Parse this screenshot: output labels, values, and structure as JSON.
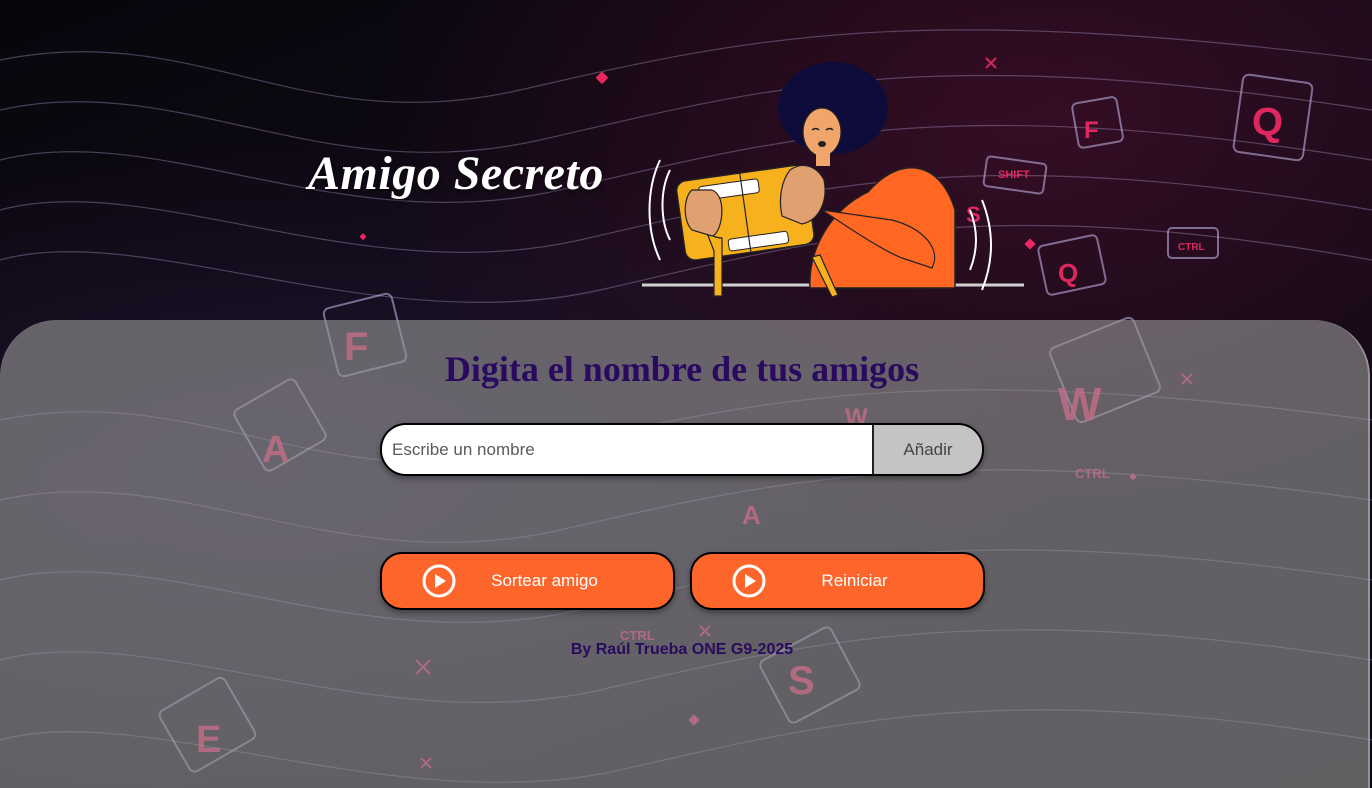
{
  "header": {
    "title": "Amigo Secreto",
    "illustration_icon": "person-opening-gift-illustration"
  },
  "main": {
    "subtitle": "Digita el nombre de tus amigos",
    "name_input": {
      "placeholder": "Escribe un nombre",
      "value": ""
    },
    "add_button_label": "Añadir",
    "draw_button": {
      "label": "Sortear amigo",
      "icon": "play-circle-icon"
    },
    "reset_button": {
      "label": "Reiniciar",
      "icon": "play-circle-icon"
    },
    "credit": "By Raúl Trueba ONE G9-2025"
  },
  "colors": {
    "accent_orange": "#fe652b",
    "heading_purple": "#2a0a5e",
    "panel_gray": "#969696",
    "add_button_gray": "#c4c4c4"
  }
}
